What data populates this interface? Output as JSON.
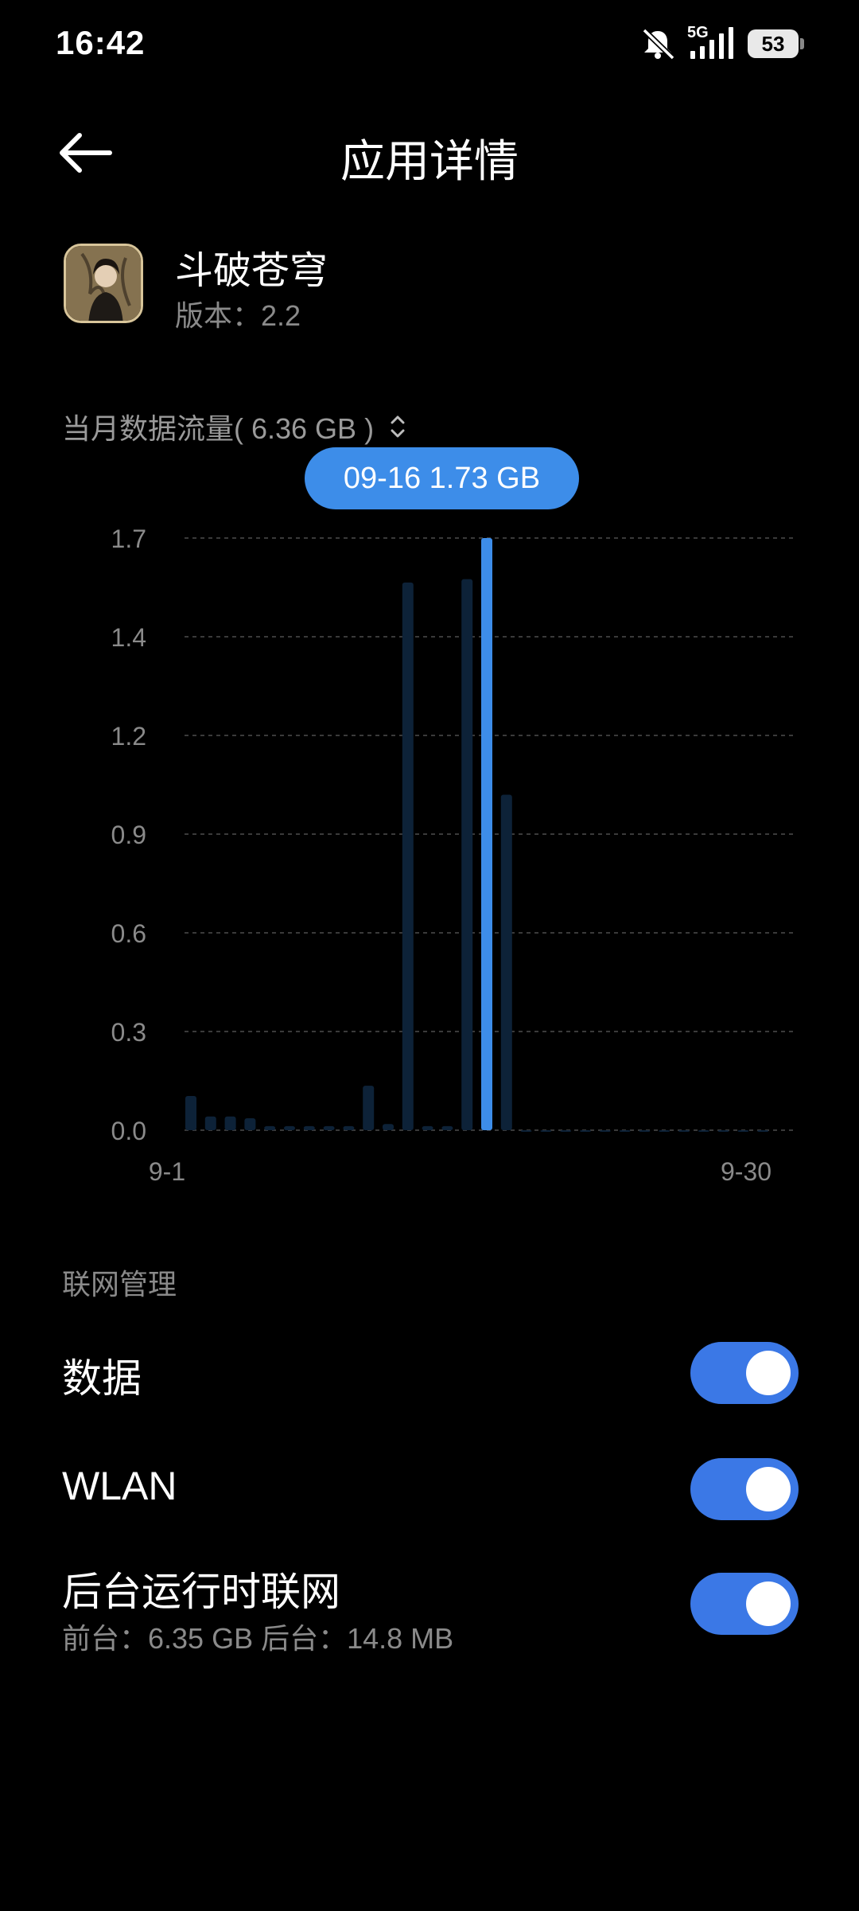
{
  "status_bar": {
    "time": "16:42",
    "network": "5G",
    "battery": "53"
  },
  "header": {
    "title": "应用详情"
  },
  "app": {
    "name": "斗破苍穹",
    "version": "版本：2.2"
  },
  "usage": {
    "label": "当月数据流量( 6.36 GB )",
    "tooltip": "09-16 1.73 GB"
  },
  "chart_data": {
    "type": "bar",
    "title": "",
    "xlabel": "",
    "ylabel": "",
    "y_ticks": [
      "0.0",
      "0.3",
      "0.6",
      "0.9",
      "1.2",
      "1.4",
      "1.7"
    ],
    "ylim": [
      0,
      1.73
    ],
    "x_tick_labels": [
      "9-1",
      "9-30"
    ],
    "categories": [
      "9-1",
      "9-2",
      "9-3",
      "9-4",
      "9-5",
      "9-6",
      "9-7",
      "9-8",
      "9-9",
      "9-10",
      "9-11",
      "9-12",
      "9-13",
      "9-14",
      "9-15",
      "9-16",
      "9-17",
      "9-18",
      "9-19",
      "9-20",
      "9-21",
      "9-22",
      "9-23",
      "9-24",
      "9-25",
      "9-26",
      "9-27",
      "9-28",
      "9-29",
      "9-30"
    ],
    "values": [
      0.1,
      0.04,
      0.04,
      0.035,
      0.012,
      0.012,
      0.012,
      0.012,
      0.012,
      0.13,
      0.018,
      1.6,
      0.012,
      0.012,
      1.61,
      1.73,
      0.98,
      0,
      0,
      0,
      0,
      0,
      0,
      0,
      0,
      0,
      0,
      0,
      0,
      0
    ],
    "highlight": "9-16",
    "colors": {
      "highlight": "#3d8de9",
      "normal": "#0d2238",
      "grid": "#3a3a3a"
    },
    "grid": true
  },
  "network_section": {
    "title": "联网管理",
    "rows": [
      {
        "label": "数据",
        "on": true
      },
      {
        "label": "WLAN",
        "on": true
      },
      {
        "label": "后台运行时联网",
        "sub": "前台：6.35 GB  后台：14.8 MB",
        "on": true
      }
    ]
  }
}
